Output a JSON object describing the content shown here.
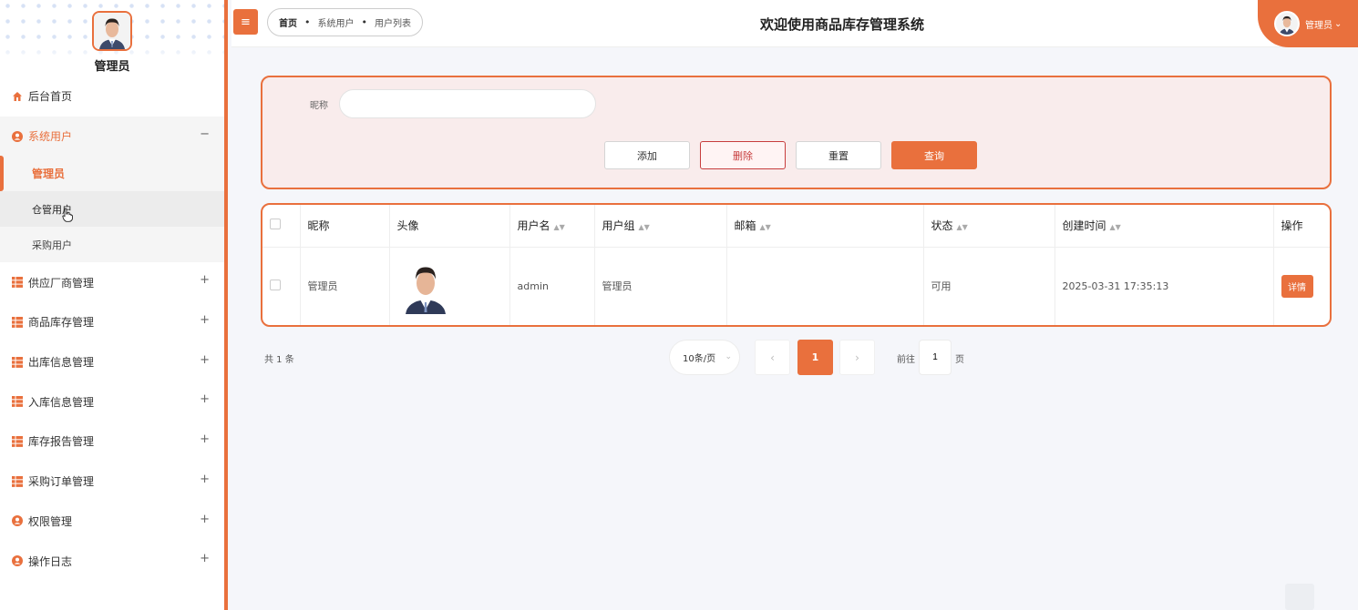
{
  "colors": {
    "accent": "#e9703d",
    "danger": "#c73d3d",
    "panel_bg": "#f9ecec"
  },
  "sidebar": {
    "admin_name": "管理员",
    "avatar_icon": "user-avatar-photo",
    "items": [
      {
        "label": "后台首页",
        "icon": "home-icon",
        "toggle": ""
      },
      {
        "label": "系统用户",
        "icon": "user-circle-icon",
        "toggle": "−"
      },
      {
        "label": "供应厂商管理",
        "icon": "grid-icon",
        "toggle": "+"
      },
      {
        "label": "商品库存管理",
        "icon": "grid-icon",
        "toggle": "+"
      },
      {
        "label": "出库信息管理",
        "icon": "grid-icon",
        "toggle": "+"
      },
      {
        "label": "入库信息管理",
        "icon": "grid-icon",
        "toggle": "+"
      },
      {
        "label": "库存报告管理",
        "icon": "grid-icon",
        "toggle": "+"
      },
      {
        "label": "采购订单管理",
        "icon": "grid-icon",
        "toggle": "+"
      },
      {
        "label": "权限管理",
        "icon": "user-circle-icon",
        "toggle": "+"
      },
      {
        "label": "操作日志",
        "icon": "user-circle-icon",
        "toggle": "+"
      }
    ],
    "sub_items": [
      {
        "label": "管理员"
      },
      {
        "label": "仓管用户"
      },
      {
        "label": "采购用户"
      }
    ]
  },
  "header": {
    "menu_toggle_icon": "≡",
    "breadcrumb": [
      "首页",
      "系统用户",
      "用户列表"
    ],
    "title": "欢迎使用商品库存管理系统",
    "user_name": "管理员",
    "user_caret": "⌄"
  },
  "search": {
    "label": "昵称",
    "value": "",
    "placeholder": "",
    "buttons": {
      "add": "添加",
      "delete": "删除",
      "reset": "重置",
      "query": "查询"
    }
  },
  "table": {
    "columns": [
      "昵称",
      "头像",
      "用户名",
      "用户组",
      "邮箱",
      "状态",
      "创建时间",
      "操作"
    ],
    "sortable": [
      false,
      false,
      true,
      true,
      true,
      true,
      true,
      false
    ],
    "rows": [
      {
        "nickname": "管理员",
        "username": "admin",
        "group": "管理员",
        "email": "",
        "status": "可用",
        "created": "2025-03-31 17:35:13",
        "action": "详情"
      }
    ]
  },
  "pagination": {
    "total_text": "共 1 条",
    "page_size": "10条/页",
    "current_page": "1",
    "prev": "‹",
    "next": "›",
    "goto_label": "前往",
    "goto_value": "1",
    "goto_suffix": "页"
  }
}
